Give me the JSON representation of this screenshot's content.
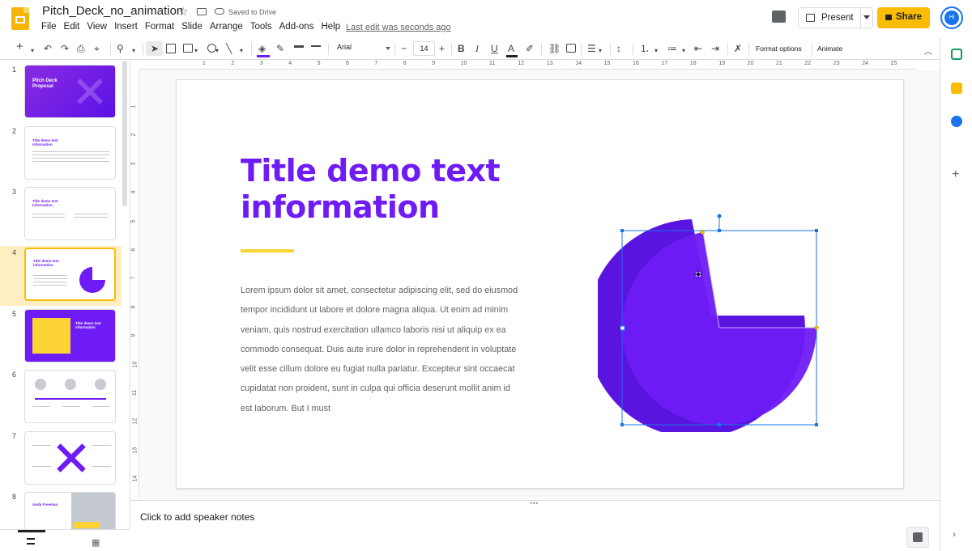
{
  "app": {
    "doc_title": "Pitch_Deck_no_animation",
    "saved_status": "Saved to Drive",
    "last_edit": "Last edit was seconds ago",
    "menu": [
      "File",
      "Edit",
      "View",
      "Insert",
      "Format",
      "Slide",
      "Arrange",
      "Tools",
      "Add-ons",
      "Help"
    ],
    "present_label": "Present",
    "share_label": "Share",
    "avatar_initials": "Hi"
  },
  "toolbar": {
    "font": "Arial",
    "font_size": "14",
    "format_options": "Format options",
    "animate": "Animate"
  },
  "ruler": {
    "h_numbers": [
      "1",
      "2",
      "3",
      "4",
      "5",
      "6",
      "7",
      "8",
      "9",
      "10",
      "11",
      "12",
      "13",
      "14",
      "15",
      "16",
      "17",
      "18",
      "19",
      "20",
      "21",
      "22",
      "23",
      "24",
      "25"
    ],
    "v_numbers": [
      "1",
      "2",
      "3",
      "4",
      "5",
      "6",
      "7",
      "8",
      "9",
      "10",
      "11",
      "12",
      "13",
      "14"
    ]
  },
  "filmstrip": {
    "slides": [
      {
        "num": "1",
        "title": "Pitch Deck Proposal"
      },
      {
        "num": "2",
        "title": "Title demo text information"
      },
      {
        "num": "3",
        "title": "Title demo text information"
      },
      {
        "num": "4",
        "title": "Title demo text information"
      },
      {
        "num": "5",
        "title": "Title demo text information"
      },
      {
        "num": "6",
        "title": ""
      },
      {
        "num": "7",
        "title": ""
      },
      {
        "num": "8",
        "title": "Andy Freeman"
      }
    ],
    "selected": "4"
  },
  "slide": {
    "title": "Title demo text information",
    "body": "Lorem ipsum dolor sit amet, consectetur adipiscing elit, sed do eiusmod tempor incididunt ut labore et dolore magna aliqua. Ut enim ad minim veniam, quis nostrud exercitation ullamco laboris nisi ut aliquip ex ea commodo consequat. Duis aute irure dolor in reprehenderit in voluptate velit esse cillum dolore eu fugiat nulla pariatur. Excepteur sint occaecat cupidatat non proident, sunt in culpa qui officia deserunt mollit anim id est laborum. But I must"
  },
  "notes": {
    "placeholder": "Click to add speaker notes"
  },
  "colors": {
    "brand_purple": "#6e1bf5",
    "accent_yellow": "#fbd334",
    "share_yellow": "#fbbc04",
    "selection_blue": "#1a73e8"
  }
}
